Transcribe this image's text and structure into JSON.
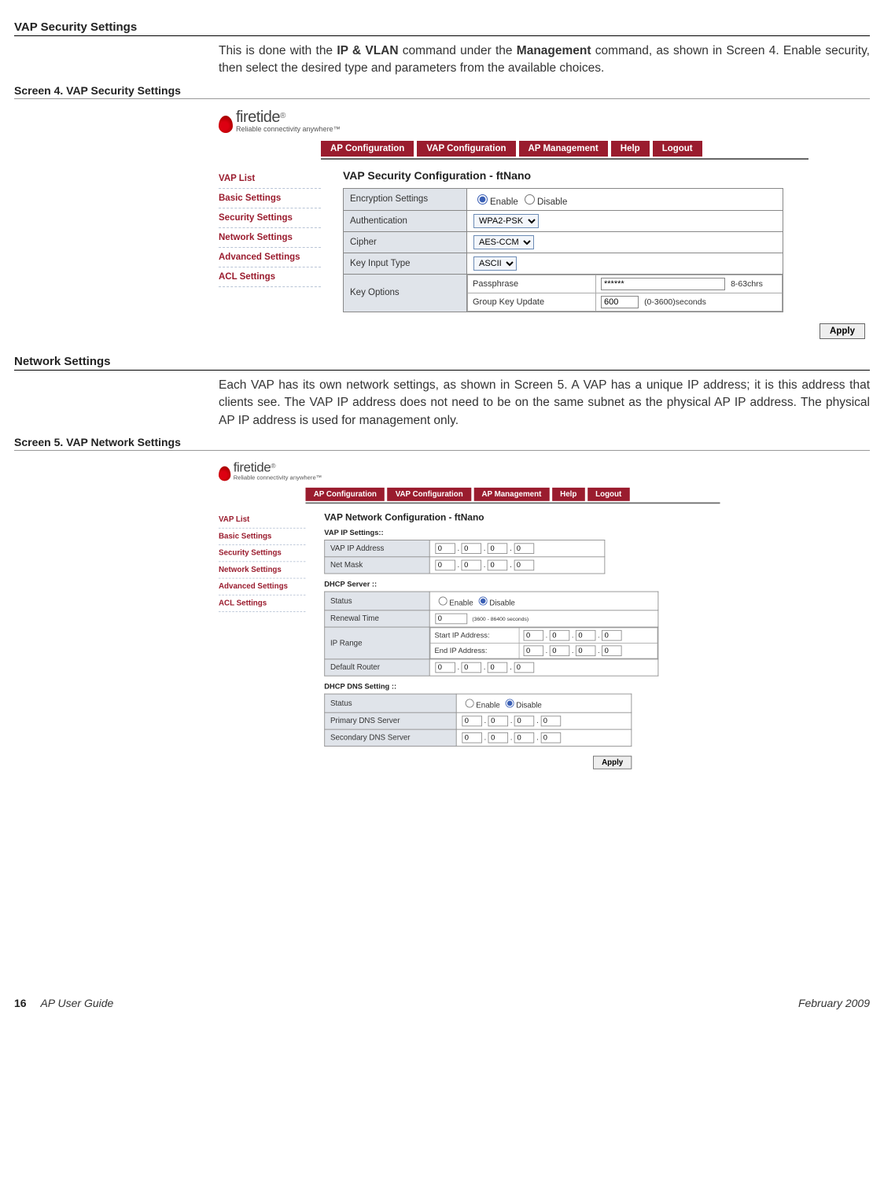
{
  "page": {
    "section1_title": "VAP Security Settings",
    "body1_prefix": "This is done with the ",
    "body1_bold1": "IP & VLAN",
    "body1_mid": " command under the ",
    "body1_bold2": "Management",
    "body1_suffix": " command, as shown in Screen 4. Enable security, then select the desired type and parameters from the available choices.",
    "screen4_caption": "Screen 4. VAP Security Settings",
    "section2_title": "Network Settings",
    "body2": "Each VAP has its own network settings, as shown in Screen 5. A VAP has a unique IP address; it is this address that clients see. The VAP IP address does not need to be on the same subnet as the physical AP IP address. The physical AP IP address is used for management only.",
    "screen5_caption": "Screen 5. VAP Network Settings",
    "page_number": "16",
    "guide_label": "AP User Guide",
    "date_label": "February 2009"
  },
  "brand": {
    "name": "firetide",
    "reg": "®",
    "tagline": "Reliable connectivity anywhere™"
  },
  "topnav": {
    "items": [
      "AP Configuration",
      "VAP Configuration",
      "AP Management",
      "Help",
      "Logout"
    ]
  },
  "sidenav": {
    "items": [
      "VAP List",
      "Basic Settings",
      "Security Settings",
      "Network Settings",
      "Advanced Settings",
      "ACL Settings"
    ]
  },
  "sec_screen": {
    "title": "VAP Security Configuration - ftNano",
    "rows": {
      "encryption_label": "Encryption Settings",
      "enable": "Enable",
      "disable": "Disable",
      "auth_label": "Authentication",
      "auth_value": "WPA2-PSK",
      "cipher_label": "Cipher",
      "cipher_value": "AES-CCM",
      "key_input_label": "Key Input Type",
      "key_input_value": "ASCII",
      "key_options_label": "Key Options",
      "passphrase_label": "Passphrase",
      "passphrase_value": "******",
      "passphrase_hint": "8-63chrs",
      "group_key_label": "Group Key Update",
      "group_key_value": "600",
      "group_key_hint": "(0-3600)seconds"
    },
    "apply": "Apply"
  },
  "net_screen": {
    "title": "VAP Network Configuration - ftNano",
    "vap_ip_heading": "VAP IP Settings::",
    "vap_ip_label": "VAP IP Address",
    "netmask_label": "Net Mask",
    "ip_octet": "0",
    "dhcp_heading": "DHCP Server ::",
    "status_label": "Status",
    "enable": "Enable",
    "disable": "Disable",
    "renewal_label": "Renewal Time",
    "renewal_value": "0",
    "renewal_hint": "(3600 - 86400 seconds)",
    "ip_range_label": "IP Range",
    "start_ip_label": "Start IP Address:",
    "end_ip_label": "End IP Address:",
    "default_router_label": "Default Router",
    "dns_heading": "DHCP DNS Setting ::",
    "primary_dns_label": "Primary DNS Server",
    "secondary_dns_label": "Secondary DNS Server",
    "apply": "Apply"
  }
}
